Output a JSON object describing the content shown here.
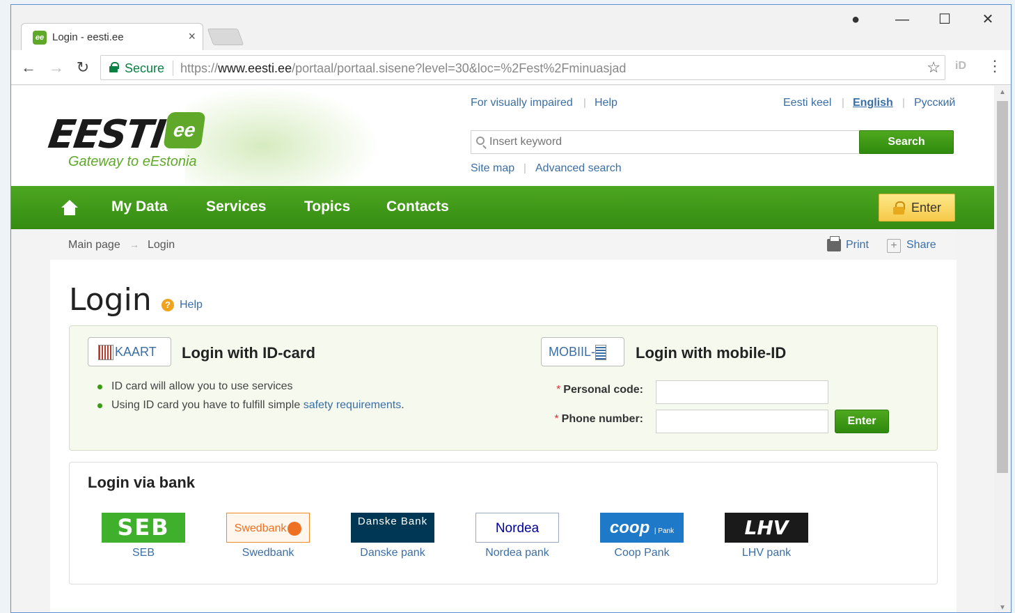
{
  "browser": {
    "tab_title": "Login - eesti.ee",
    "tab_favicon": "ee",
    "secure_label": "Secure",
    "url_scheme": "https://",
    "url_host": "www.eesti.ee",
    "url_path": "/portaal/portaal.sisene?level=30&loc=%2Fest%2Fminuasjad",
    "extension_label": "iD"
  },
  "site": {
    "logo_text": "EESTI",
    "logo_badge": "ee",
    "tagline": "Gateway to eEstonia",
    "top_links": {
      "visually_impaired": "For visually impaired",
      "help": "Help",
      "lang_et": "Eesti keel",
      "lang_en": "English",
      "lang_ru": "Русский"
    },
    "search": {
      "placeholder": "Insert keyword",
      "button": "Search",
      "site_map": "Site map",
      "advanced": "Advanced search"
    },
    "nav": {
      "items": [
        "My Data",
        "Services",
        "Topics",
        "Contacts"
      ],
      "enter": "Enter"
    },
    "accent_color": "#3c9a16"
  },
  "breadcrumb": {
    "items": [
      "Main page",
      "Login"
    ],
    "arrow": "→",
    "print": "Print",
    "share": "Share"
  },
  "page": {
    "title": "Login",
    "help": "Help"
  },
  "idcard": {
    "badge": "KAART",
    "heading": "Login with ID-card",
    "bullet_1": "ID card will allow you to use services",
    "bullet_2_text": "Using ID card you have to fulfill simple",
    "bullet_2_link": "safety requirements",
    "bullet_2_end": "."
  },
  "mobileid": {
    "badge": "MOBIIL-",
    "heading": "Login with mobile-ID",
    "personal_code_label": "Personal code:",
    "phone_label": "Phone number:",
    "personal_code_value": "",
    "phone_value": "",
    "enter": "Enter"
  },
  "banks": {
    "heading": "Login via bank",
    "items": [
      {
        "logo": "SEB",
        "name": "SEB"
      },
      {
        "logo": "Swedbank",
        "name": "Swedbank"
      },
      {
        "logo": "Danske Bank",
        "name": "Danske pank"
      },
      {
        "logo": "Nordea",
        "name": "Nordea pank"
      },
      {
        "logo": "coop",
        "name": "Coop Pank"
      },
      {
        "logo": "LHV",
        "name": "LHV pank"
      }
    ]
  }
}
